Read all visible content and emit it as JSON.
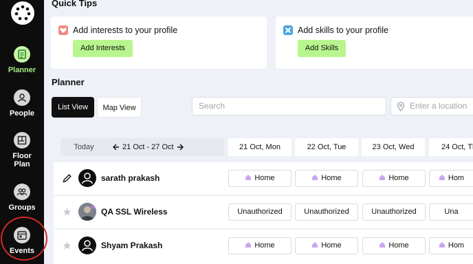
{
  "sidebar": {
    "logo": "logo-icon",
    "items": [
      {
        "label": "Planner",
        "icon": "planner-icon",
        "active": true
      },
      {
        "label": "People",
        "icon": "person-icon"
      },
      {
        "label": "Floor Plan",
        "icon": "floor-plan-icon"
      },
      {
        "label": "Groups",
        "icon": "groups-icon"
      },
      {
        "label": "Events",
        "icon": "calendar-icon"
      }
    ]
  },
  "quick_tips": {
    "title": "Quick Tips",
    "cards": [
      {
        "text": "Add interests to your profile",
        "button": "Add Interests",
        "icon": "heart-icon",
        "icon_color": "#f08a80"
      },
      {
        "text": "Add skills to your profile",
        "button": "Add Skills",
        "icon": "tools-icon",
        "icon_color": "#4aa3df"
      }
    ]
  },
  "planner": {
    "title": "Planner",
    "tabs": [
      {
        "label": "List View",
        "active": true
      },
      {
        "label": "Map View",
        "active": false
      }
    ],
    "search_placeholder": "Search",
    "location_placeholder": "Enter a location",
    "today_label": "Today",
    "week_range": "21 Oct - 27 Oct",
    "days": [
      "21 Oct, Mon",
      "22 Oct, Tue",
      "23 Oct, Wed",
      "24 Oct, Th"
    ],
    "rows": [
      {
        "icon": "pencil-icon",
        "name": "sarath prakash",
        "avatar": "default",
        "cells": [
          "Home",
          "Home",
          "Home",
          "Hom"
        ]
      },
      {
        "icon": "star-icon",
        "name": "QA SSL Wireless",
        "avatar": "photo",
        "cells": [
          "Unauthorized",
          "Unauthorized",
          "Unauthorized",
          "Una"
        ]
      },
      {
        "icon": "star-icon",
        "name": "Shyam Prakash",
        "avatar": "default",
        "cells": [
          "Home",
          "Home",
          "Home",
          "Hom"
        ]
      }
    ]
  },
  "colors": {
    "sidebar_bg": "#0d0d0d",
    "accent_green": "#b9f58e",
    "active_label": "#a6ec80",
    "highlight_ring": "#d62828",
    "home_icon": "#c9a6f0"
  }
}
